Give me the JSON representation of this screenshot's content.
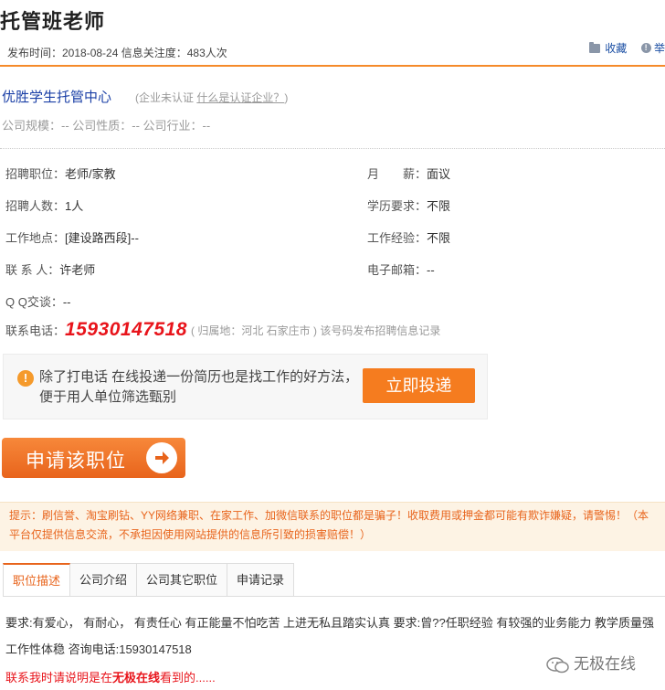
{
  "header": {
    "title": "托管班老师",
    "meta": "发布时间：2018-08-24 信息关注度：483人次",
    "favorite_label": "收藏",
    "report_label": "举"
  },
  "company": {
    "name": "优胜学生托管中心",
    "cert_status": "(企业未认证 ",
    "cert_link": "什么是认证企业？",
    "cert_close": ")",
    "info": "公司规模：-- 公司性质：-- 公司行业：--"
  },
  "job": {
    "position_label": "招聘职位：",
    "position_value": "老师/家教",
    "salary_label": "月　　薪：",
    "salary_value": "面议",
    "count_label": "招聘人数：",
    "count_value": "1人",
    "education_label": "学历要求：",
    "education_value": "不限",
    "location_label": "工作地点：",
    "location_value": "[建设路西段]--",
    "experience_label": "工作经验：",
    "experience_value": "不限",
    "contact_label": "联 系 人：",
    "contact_value": "许老师",
    "email_label": "电子邮箱：",
    "email_value": "--",
    "qq_label": "Q Q交谈：",
    "qq_value": "--",
    "phone_label": "联系电话：",
    "phone_value": "15930147518",
    "phone_note": "( 归属地：河北 石家庄市 ) 该号码发布招聘信息记录"
  },
  "tip": {
    "icon": "exclamation-icon",
    "text": "除了打电话 在线投递一份简历也是找工作的好方法，便于用人单位筛选甄别",
    "button": "立即投递"
  },
  "apply": {
    "label": "申请该职位",
    "icon": "arrow-right-icon"
  },
  "warning": "提示：刷信誉、淘宝刷钻、YY网络兼职、在家工作、加微信联系的职位都是骗子！收取费用或押金都可能有欺诈嫌疑，请警惕！（本平台仅提供信息交流，不承担因使用网站提供的信息所引致的损害赔偿！）",
  "tabs": [
    "职位描述",
    "公司介绍",
    "公司其它职位",
    "申请记录"
  ],
  "description": "要求:有爱心， 有耐心， 有责任心 有正能量不怕吃苦 上进无私且踏实认真 要求:曾??任职经验 有较强的业务能力 教学质量强 工作性体稳 咨询电话:15930147518",
  "notice": {
    "prefix": "联系我时请说明是在",
    "brand": "无极在线",
    "suffix": "看到的......"
  },
  "watermark": "无极在线",
  "colors": {
    "accent": "#f58a2a",
    "phone": "#e8141b",
    "link": "#1a3fa6"
  }
}
